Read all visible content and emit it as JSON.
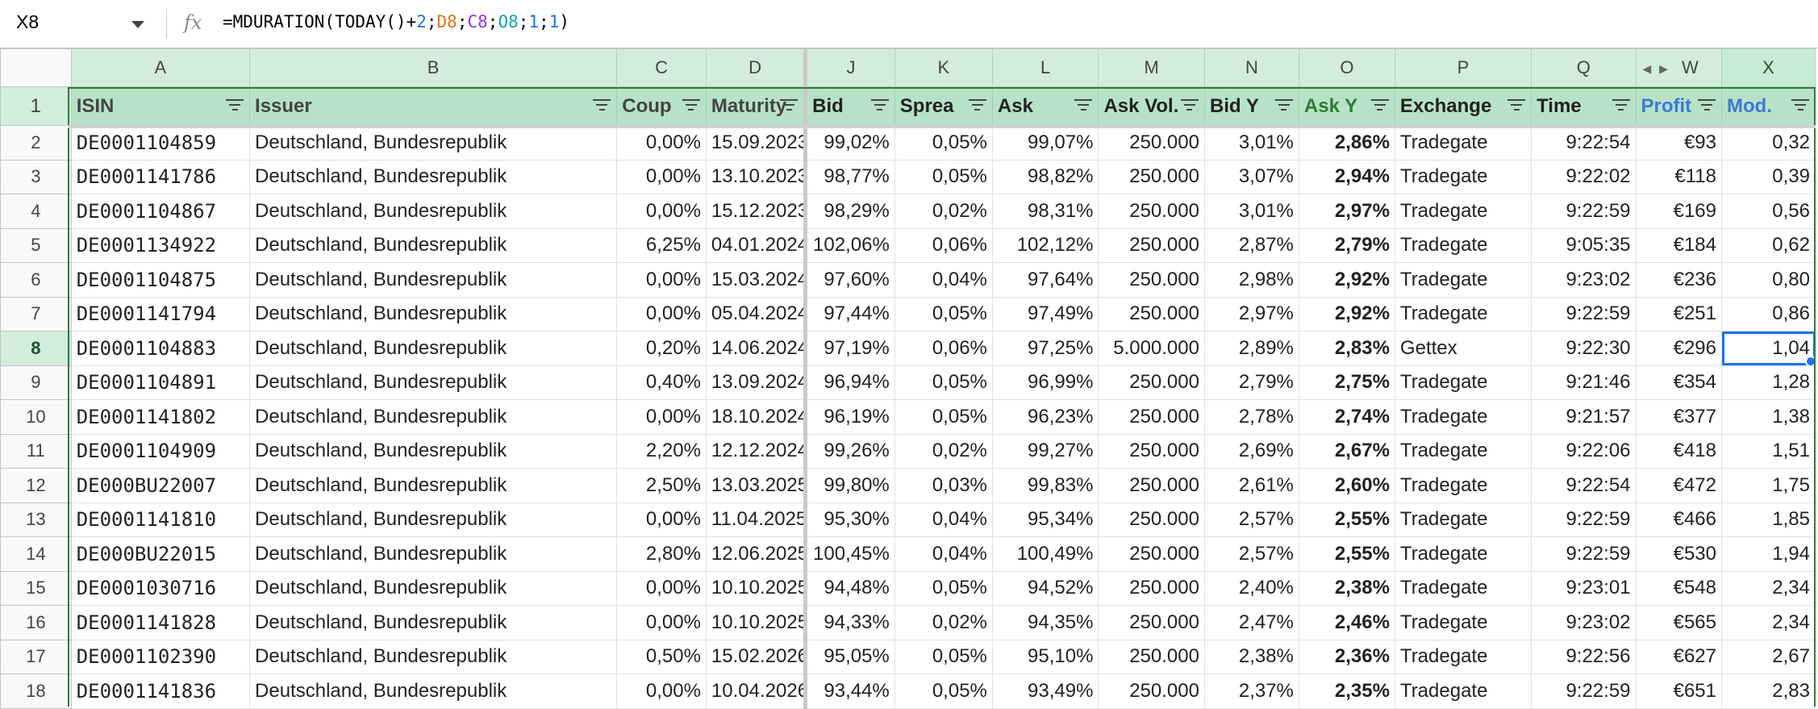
{
  "name_box": "X8",
  "formula_tokens": [
    {
      "t": "=MDURATION(TODAY()+",
      "c": "#000000"
    },
    {
      "t": "2",
      "c": "#1a73e8"
    },
    {
      "t": ";",
      "c": "#000000"
    },
    {
      "t": "D8",
      "c": "#e8710a"
    },
    {
      "t": ";",
      "c": "#000000"
    },
    {
      "t": "C8",
      "c": "#9334e6"
    },
    {
      "t": ";",
      "c": "#000000"
    },
    {
      "t": "O8",
      "c": "#12a4af"
    },
    {
      "t": ";",
      "c": "#000000"
    },
    {
      "t": "1",
      "c": "#1a73e8"
    },
    {
      "t": ";",
      "c": "#000000"
    },
    {
      "t": "1",
      "c": "#1a73e8"
    },
    {
      "t": ")",
      "c": "#000000"
    }
  ],
  "columns": [
    "A",
    "B",
    "C",
    "D",
    "J",
    "K",
    "L",
    "M",
    "N",
    "O",
    "P",
    "Q",
    "W",
    "X"
  ],
  "headers": [
    "ISIN",
    "Issuer",
    "Coup",
    "Maturity",
    "Bid",
    "Sprea",
    "Ask",
    "Ask Vol.",
    "Bid Y",
    "Ask Y",
    "Exchange",
    "Time",
    "Profit",
    "Mod."
  ],
  "header_colors": [
    "#444444",
    "#444444",
    "#444444",
    "#444444",
    "#222222",
    "#222222",
    "#222222",
    "#222222",
    "#222222",
    "#2e7d32",
    "#222222",
    "#222222",
    "#3c78d8",
    "#3c78d8"
  ],
  "header_row_num": "1",
  "rows": [
    {
      "n": "2",
      "cells": [
        "DE0001104859",
        "Deutschland, Bundesrepublik",
        "0,00%",
        "15.09.2023",
        "99,02%",
        "0,05%",
        "99,07%",
        "250.000",
        "3,01%",
        "2,86%",
        "Tradegate",
        "9:22:54",
        "€93",
        "0,32"
      ]
    },
    {
      "n": "3",
      "cells": [
        "DE0001141786",
        "Deutschland, Bundesrepublik",
        "0,00%",
        "13.10.2023",
        "98,77%",
        "0,05%",
        "98,82%",
        "250.000",
        "3,07%",
        "2,94%",
        "Tradegate",
        "9:22:02",
        "€118",
        "0,39"
      ]
    },
    {
      "n": "4",
      "cells": [
        "DE0001104867",
        "Deutschland, Bundesrepublik",
        "0,00%",
        "15.12.2023",
        "98,29%",
        "0,02%",
        "98,31%",
        "250.000",
        "3,01%",
        "2,97%",
        "Tradegate",
        "9:22:59",
        "€169",
        "0,56"
      ]
    },
    {
      "n": "5",
      "cells": [
        "DE0001134922",
        "Deutschland, Bundesrepublik",
        "6,25%",
        "04.01.2024",
        "102,06%",
        "0,06%",
        "102,12%",
        "250.000",
        "2,87%",
        "2,79%",
        "Tradegate",
        "9:05:35",
        "€184",
        "0,62"
      ]
    },
    {
      "n": "6",
      "cells": [
        "DE0001104875",
        "Deutschland, Bundesrepublik",
        "0,00%",
        "15.03.2024",
        "97,60%",
        "0,04%",
        "97,64%",
        "250.000",
        "2,98%",
        "2,92%",
        "Tradegate",
        "9:23:02",
        "€236",
        "0,80"
      ]
    },
    {
      "n": "7",
      "cells": [
        "DE0001141794",
        "Deutschland, Bundesrepublik",
        "0,00%",
        "05.04.2024",
        "97,44%",
        "0,05%",
        "97,49%",
        "250.000",
        "2,97%",
        "2,92%",
        "Tradegate",
        "9:22:59",
        "€251",
        "0,86"
      ]
    },
    {
      "n": "8",
      "cells": [
        "DE0001104883",
        "Deutschland, Bundesrepublik",
        "0,20%",
        "14.06.2024",
        "97,19%",
        "0,06%",
        "97,25%",
        "5.000.000",
        "2,89%",
        "2,83%",
        "Gettex",
        "9:22:30",
        "€296",
        "1,04"
      ]
    },
    {
      "n": "9",
      "cells": [
        "DE0001104891",
        "Deutschland, Bundesrepublik",
        "0,40%",
        "13.09.2024",
        "96,94%",
        "0,05%",
        "96,99%",
        "250.000",
        "2,79%",
        "2,75%",
        "Tradegate",
        "9:21:46",
        "€354",
        "1,28"
      ]
    },
    {
      "n": "10",
      "cells": [
        "DE0001141802",
        "Deutschland, Bundesrepublik",
        "0,00%",
        "18.10.2024",
        "96,19%",
        "0,05%",
        "96,23%",
        "250.000",
        "2,78%",
        "2,74%",
        "Tradegate",
        "9:21:57",
        "€377",
        "1,38"
      ]
    },
    {
      "n": "11",
      "cells": [
        "DE0001104909",
        "Deutschland, Bundesrepublik",
        "2,20%",
        "12.12.2024",
        "99,26%",
        "0,02%",
        "99,27%",
        "250.000",
        "2,69%",
        "2,67%",
        "Tradegate",
        "9:22:06",
        "€418",
        "1,51"
      ]
    },
    {
      "n": "12",
      "cells": [
        "DE000BU22007",
        "Deutschland, Bundesrepublik",
        "2,50%",
        "13.03.2025",
        "99,80%",
        "0,03%",
        "99,83%",
        "250.000",
        "2,61%",
        "2,60%",
        "Tradegate",
        "9:22:54",
        "€472",
        "1,75"
      ]
    },
    {
      "n": "13",
      "cells": [
        "DE0001141810",
        "Deutschland, Bundesrepublik",
        "0,00%",
        "11.04.2025",
        "95,30%",
        "0,04%",
        "95,34%",
        "250.000",
        "2,57%",
        "2,55%",
        "Tradegate",
        "9:22:59",
        "€466",
        "1,85"
      ]
    },
    {
      "n": "14",
      "cells": [
        "DE000BU22015",
        "Deutschland, Bundesrepublik",
        "2,80%",
        "12.06.2025",
        "100,45%",
        "0,04%",
        "100,49%",
        "250.000",
        "2,57%",
        "2,55%",
        "Tradegate",
        "9:22:59",
        "€530",
        "1,94"
      ]
    },
    {
      "n": "15",
      "cells": [
        "DE0001030716",
        "Deutschland, Bundesrepublik",
        "0,00%",
        "10.10.2025",
        "94,48%",
        "0,05%",
        "94,52%",
        "250.000",
        "2,40%",
        "2,38%",
        "Tradegate",
        "9:23:01",
        "€548",
        "2,34"
      ]
    },
    {
      "n": "16",
      "cells": [
        "DE0001141828",
        "Deutschland, Bundesrepublik",
        "0,00%",
        "10.10.2025",
        "94,33%",
        "0,02%",
        "94,35%",
        "250.000",
        "2,47%",
        "2,46%",
        "Tradegate",
        "9:23:02",
        "€565",
        "2,34"
      ]
    },
    {
      "n": "17",
      "cells": [
        "DE0001102390",
        "Deutschland, Bundesrepublik",
        "0,50%",
        "15.02.2026",
        "95,05%",
        "0,05%",
        "95,10%",
        "250.000",
        "2,38%",
        "2,36%",
        "Tradegate",
        "9:22:56",
        "€627",
        "2,67"
      ]
    },
    {
      "n": "18",
      "cells": [
        "DE0001141836",
        "Deutschland, Bundesrepublik",
        "0,00%",
        "10.04.2026",
        "93,44%",
        "0,05%",
        "93,49%",
        "250.000",
        "2,37%",
        "2,35%",
        "Tradegate",
        "9:22:59",
        "€651",
        "2,83"
      ]
    }
  ],
  "selected_cell": {
    "row": "8",
    "col": "X"
  }
}
